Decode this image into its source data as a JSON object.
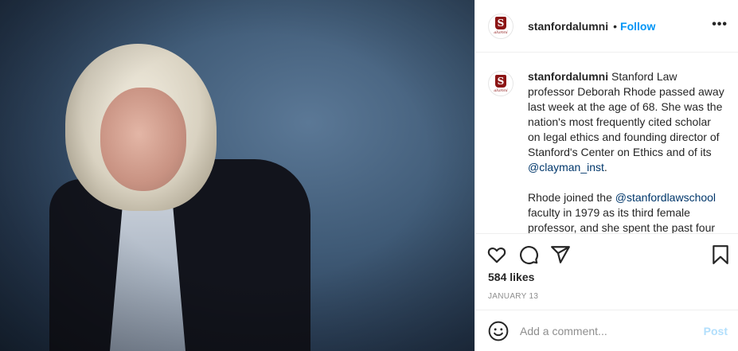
{
  "post": {
    "username": "stanfordalumni",
    "follow_separator": "•",
    "follow_label": "Follow",
    "more_label": "•••",
    "avatar_letter": "S",
    "avatar_script": "alumni",
    "caption": {
      "username": "stanfordalumni",
      "p1_text_1": " Stanford Law professor Deborah Rhode passed away last week at the age of 68. She was the nation's most frequently cited scholar on legal ethics and founding director of Stanford's Center on Ethics and of its ",
      "p1_mention": "@clayman_inst",
      "p1_text_2": ".",
      "p2_text_1": "Rhode joined the ",
      "p2_mention": "@stanfordlawschool",
      "p2_text_2": " faculty in 1979 as its third female professor, and she spent the past four"
    },
    "icons": [
      "heart-icon",
      "comment-icon",
      "share-icon",
      "bookmark-icon",
      "emoji-icon"
    ],
    "likes": "584 likes",
    "date": "JANUARY 13",
    "comment_placeholder": "Add a comment...",
    "post_label": "Post"
  },
  "colors": {
    "accent": "#0095f6",
    "mention": "#00376b",
    "brand": "#8c1515",
    "post_disabled": "#b2dffc"
  }
}
